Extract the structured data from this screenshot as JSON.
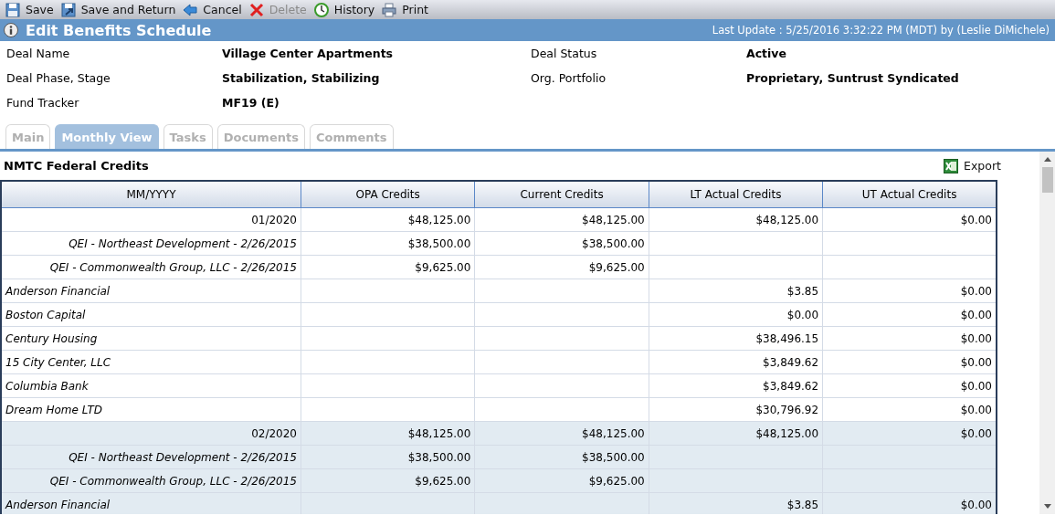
{
  "toolbar": [
    {
      "label": "Save",
      "disabled": false
    },
    {
      "label": "Save and Return",
      "disabled": false
    },
    {
      "label": "Cancel",
      "disabled": false
    },
    {
      "label": "Delete",
      "disabled": true
    },
    {
      "label": "History",
      "disabled": false
    },
    {
      "label": "Print",
      "disabled": false
    }
  ],
  "title_bar": {
    "title": "Edit Benefits Schedule",
    "last_update": "Last Update : 5/25/2016 3:32:22 PM (MDT) by (Leslie DiMichele)"
  },
  "details": [
    {
      "label": "Deal Name",
      "value": "Village Center Apartments"
    },
    {
      "label": "Deal Status",
      "value": "Active"
    },
    {
      "label": "Deal Phase, Stage",
      "value": "Stabilization, Stabilizing"
    },
    {
      "label": "Org. Portfolio",
      "value": "Proprietary, Suntrust Syndicated"
    },
    {
      "label": "Fund Tracker",
      "value": "MF19 (E)"
    }
  ],
  "tabs": [
    {
      "label": "Main",
      "selected": false
    },
    {
      "label": "Monthly View",
      "selected": true
    },
    {
      "label": "Tasks",
      "selected": false
    },
    {
      "label": "Documents",
      "selected": false
    },
    {
      "label": "Comments",
      "selected": false
    }
  ],
  "section": {
    "title": "NMTC Federal Credits",
    "export": "Export"
  },
  "table": {
    "columns": [
      "MM/YYYY",
      "OPA Credits",
      "Current Credits",
      "LT Actual Credits",
      "UT Actual Credits"
    ],
    "rows": [
      {
        "kind": "month",
        "shaded": false,
        "cells": [
          "01/2020",
          "$48,125.00",
          "$48,125.00",
          "$48,125.00",
          "$0.00"
        ]
      },
      {
        "kind": "allocation",
        "shaded": false,
        "cells": [
          "QEI - Northeast Development - 2/26/2015",
          "$38,500.00",
          "$38,500.00",
          "",
          ""
        ]
      },
      {
        "kind": "allocation",
        "shaded": false,
        "cells": [
          "QEI - Commonwealth Group, LLC - 2/26/2015",
          "$9,625.00",
          "$9,625.00",
          "",
          ""
        ]
      },
      {
        "kind": "investor",
        "shaded": false,
        "cells": [
          "Anderson Financial",
          "",
          "",
          "$3.85",
          "$0.00"
        ]
      },
      {
        "kind": "investor",
        "shaded": false,
        "cells": [
          "Boston Capital",
          "",
          "",
          "$0.00",
          "$0.00"
        ]
      },
      {
        "kind": "investor",
        "shaded": false,
        "cells": [
          "Century Housing",
          "",
          "",
          "$38,496.15",
          "$0.00"
        ]
      },
      {
        "kind": "investor",
        "shaded": false,
        "cells": [
          "15 City Center, LLC",
          "",
          "",
          "$3,849.62",
          "$0.00"
        ]
      },
      {
        "kind": "investor",
        "shaded": false,
        "cells": [
          "Columbia Bank",
          "",
          "",
          "$3,849.62",
          "$0.00"
        ]
      },
      {
        "kind": "investor",
        "shaded": false,
        "cells": [
          "Dream Home LTD",
          "",
          "",
          "$30,796.92",
          "$0.00"
        ]
      },
      {
        "kind": "month",
        "shaded": true,
        "cells": [
          "02/2020",
          "$48,125.00",
          "$48,125.00",
          "$48,125.00",
          "$0.00"
        ]
      },
      {
        "kind": "allocation",
        "shaded": true,
        "cells": [
          "QEI - Northeast Development - 2/26/2015",
          "$38,500.00",
          "$38,500.00",
          "",
          ""
        ]
      },
      {
        "kind": "allocation",
        "shaded": true,
        "cells": [
          "QEI - Commonwealth Group, LLC - 2/26/2015",
          "$9,625.00",
          "$9,625.00",
          "",
          ""
        ]
      },
      {
        "kind": "investor",
        "shaded": true,
        "cells": [
          "Anderson Financial",
          "",
          "",
          "$3.85",
          "$0.00"
        ]
      }
    ]
  }
}
